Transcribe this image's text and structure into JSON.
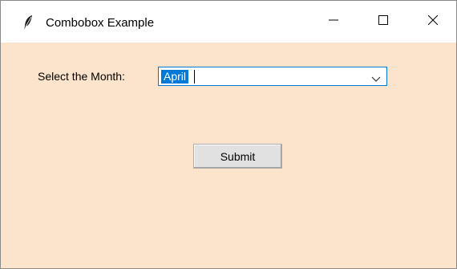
{
  "window": {
    "title": "Combobox Example",
    "icon": "feather-icon",
    "background_color": "#fce4cc"
  },
  "form": {
    "month_label": "Select the Month:",
    "month_combobox": {
      "value": "April",
      "selected": true
    },
    "submit_label": "Submit"
  },
  "colors": {
    "selection": "#0078d7",
    "combobox_border": "#0078d7"
  }
}
